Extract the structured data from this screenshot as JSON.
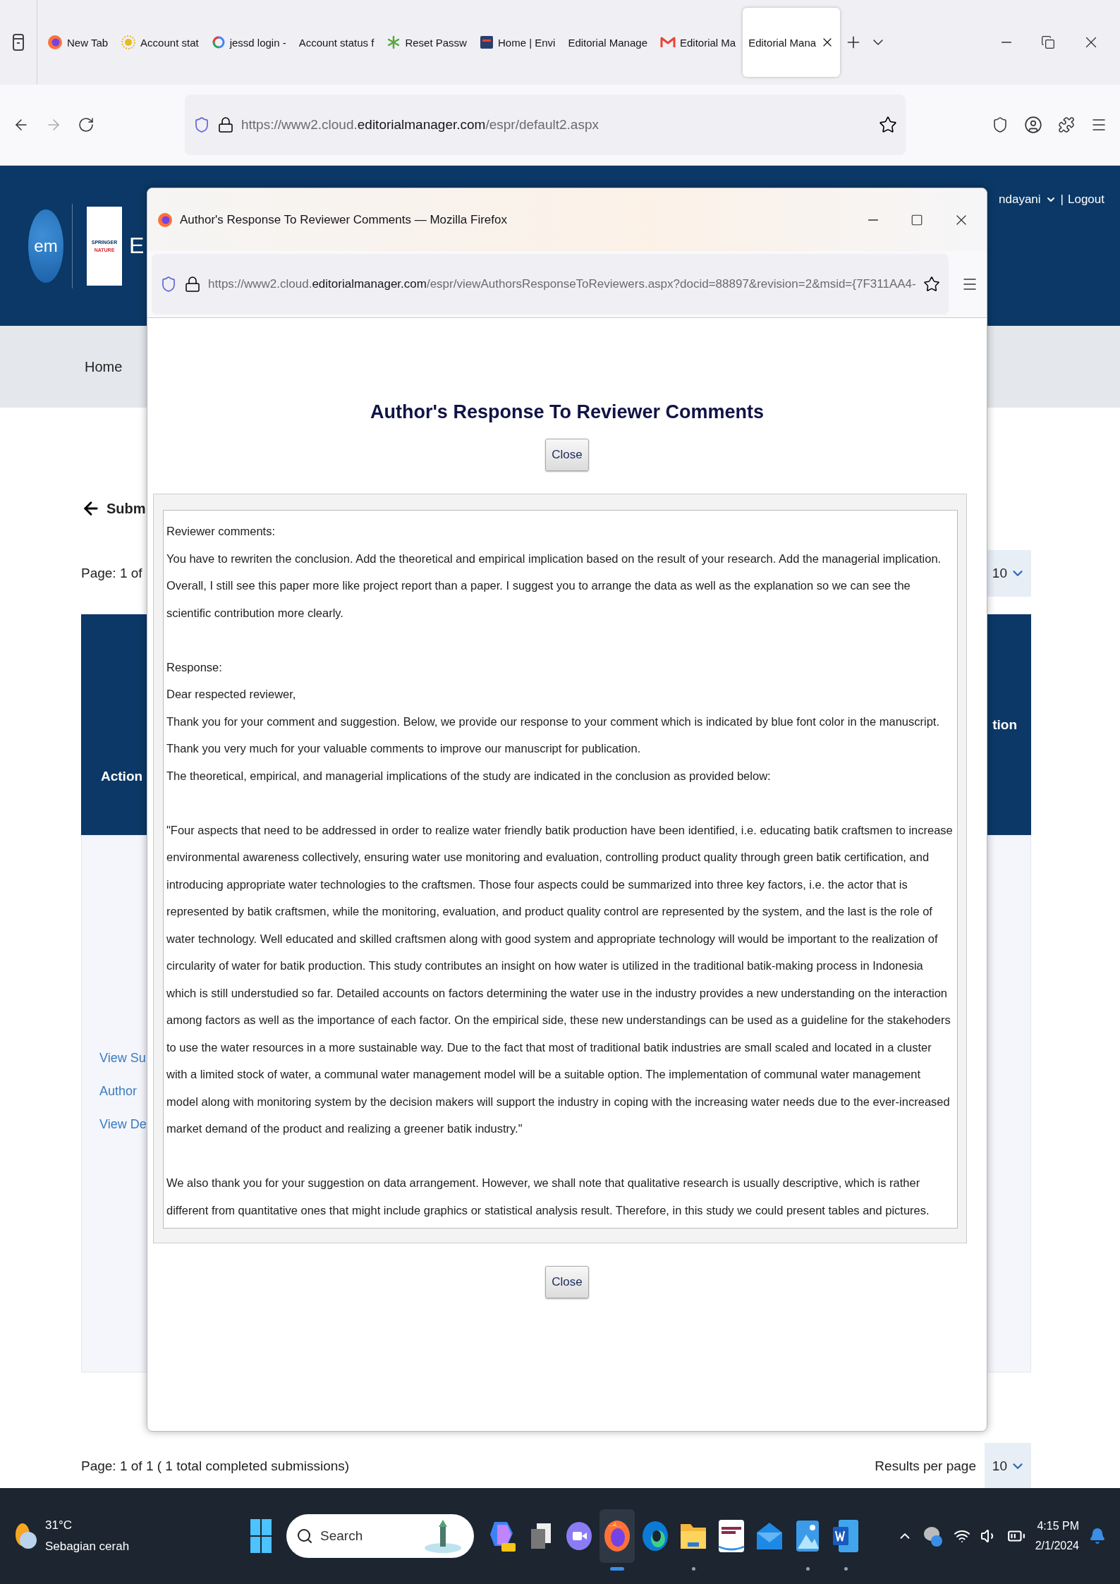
{
  "browser": {
    "tabs": [
      {
        "title": "New Tab",
        "kind": "firefox",
        "selected": false
      },
      {
        "title": "Account stat",
        "kind": "sun",
        "selected": false
      },
      {
        "title": "jessd login -",
        "kind": "google",
        "selected": false
      },
      {
        "title": "Account status f",
        "kind": "plain",
        "selected": false
      },
      {
        "title": "Reset Passw",
        "kind": "asterisk",
        "selected": false
      },
      {
        "title": "Home | Envi",
        "kind": "square",
        "selected": false
      },
      {
        "title": "Editorial Manage",
        "kind": "plain",
        "selected": false
      },
      {
        "title": "Editorial Ma",
        "kind": "mail",
        "selected": false
      },
      {
        "title": "Editorial Mana",
        "kind": "plain",
        "selected": true
      }
    ],
    "url": {
      "prefix": "https://www2.cloud.",
      "domain": "editorialmanager.com",
      "path": "/espr/default2.aspx"
    }
  },
  "page": {
    "logo": "em",
    "publisher": [
      "SPRINGER",
      "NATURE"
    ],
    "site_title": "E",
    "user": "ndayani",
    "separator": "|",
    "logout": "Logout",
    "nav": [
      "Home"
    ],
    "heading": "Subm",
    "pager_top": {
      "page": "Page: 1 of",
      "per_page": "10"
    },
    "table": {
      "header_left": "Action",
      "header_right": "tion",
      "links": [
        "View Su",
        "Author",
        "View De"
      ]
    },
    "pager_bottom": {
      "page": "Page: 1 of 1",
      "summary": "( 1 total completed submissions)",
      "per_page_label": "Results per page",
      "per_page": "10"
    }
  },
  "popup": {
    "title": "Author's Response To Reviewer Comments — Mozilla Firefox",
    "url": {
      "prefix": "https://www2.cloud.",
      "domain": "editorialmanager.com",
      "path": "/espr/viewAuthorsResponseToReviewers.aspx?docid=88897&revision=2&msid={7F311AA4-"
    },
    "heading": "Author's Response To Reviewer Comments",
    "close_buttons": [
      "Close",
      "Close"
    ],
    "sections": [
      {
        "lines": [
          "Reviewer comments:",
          "You have to rewriten the conclusion. Add the theoretical and empirical implication based on the result of your research. Add the managerial implication. Overall, I still see this paper more like project report than a paper. I suggest you to arrange the data as well as the explanation so we can see the scientific contribution more clearly."
        ]
      },
      {
        "lines": [
          "Response:",
          "Dear respected reviewer,",
          "Thank you for your comment and suggestion. Below, we provide our response to your comment which is indicated by blue font color in the manuscript.",
          "Thank you very much for your valuable comments to improve our manuscript for publication.",
          "The theoretical, empirical, and managerial implications of the study are indicated in the conclusion as provided below:"
        ]
      },
      {
        "lines": [
          "\"Four aspects that need to be addressed in order to realize water friendly batik production have been identified, i.e. educating batik craftsmen to increase environmental awareness collectively, ensuring water use monitoring and evaluation, controlling product quality through green batik certification, and introducing appropriate water technologies to the craftsmen. Those four aspects could be summarized into three key factors, i.e. the actor that is represented by batik craftsmen, while the monitoring, evaluation, and product quality control are represented by the system, and the last is the role of water technology. Well educated and skilled craftsmen along with good system and appropriate technology will would be important to the realization of circularity of water for batik production. This study contributes an insight on how water is utilized in the traditional batik-making process in Indonesia which is still understudied so far. Detailed accounts on factors determining the water use in the industry provides a new understanding on the interaction among factors as well as the importance of each factor. On the empirical side, these new understandings can be used as a guideline for the stakehoders to use the water resources in a more sustainable way. Due to the fact that most of traditional batik industries are small scaled and located in a cluster with a limited stock of water, a communal water management model will be a suitable option. The implementation of communal water management model along with monitoring system by the decision makers will support the industry in coping with the increasing water needs due to the ever-increased market demand of the product and realizing a greener batik industry.\""
        ]
      },
      {
        "lines": [
          "We also thank you for your suggestion on data arrangement. However, we shall note that qualitative research is usually descriptive, which is rather different from quantitative ones that might include graphics or statistical analysis result. Therefore, in this study we could present tables and pictures."
        ]
      }
    ]
  },
  "taskbar": {
    "weather": {
      "temp": "31°C",
      "condition": "Sebagian cerah"
    },
    "search": {
      "placeholder": "Search"
    },
    "apps": [
      {
        "kind": "copilot",
        "running": false,
        "selected": false
      },
      {
        "kind": "stack",
        "running": false,
        "selected": false
      },
      {
        "kind": "video",
        "running": false,
        "selected": false
      },
      {
        "kind": "firefox",
        "running": true,
        "selected": true
      },
      {
        "kind": "edge",
        "running": false,
        "selected": false
      },
      {
        "kind": "folder",
        "running": true,
        "selected": false
      },
      {
        "kind": "lca",
        "running": false,
        "selected": false
      },
      {
        "kind": "mail",
        "running": false,
        "selected": false
      },
      {
        "kind": "photos",
        "running": true,
        "selected": false
      },
      {
        "kind": "word",
        "running": true,
        "selected": false
      }
    ],
    "clock": {
      "time": "4:15 PM",
      "date": "2/1/2024"
    }
  }
}
